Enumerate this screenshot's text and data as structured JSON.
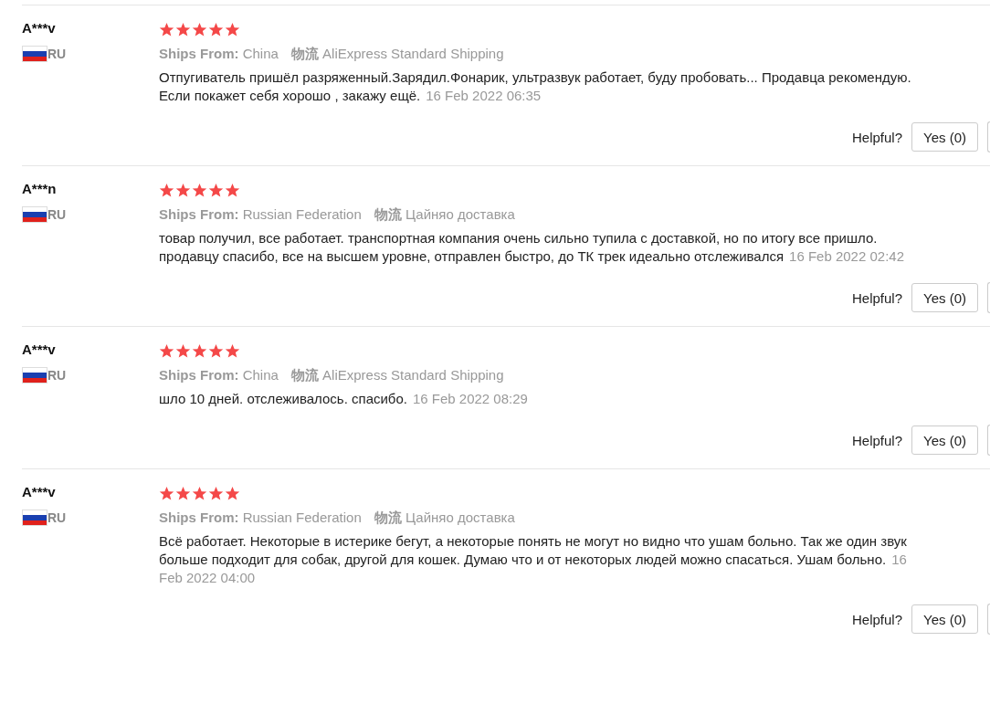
{
  "reviews": [
    {
      "user": "A***v",
      "country": "RU",
      "stars": 5,
      "ships_from_label": "Ships From:",
      "ships_from": "China",
      "logistics_label": "物流",
      "logistics": "AliExpress Standard Shipping",
      "text": "Отпугиватель пришёл разряженный.Зарядил.Фонарик, ультразвук работает, буду пробовать... Продавца рекомендую. Если покажет себя хорошо , закажу ещё.",
      "date": "16 Feb 2022 06:35",
      "helpful_label": "Helpful?",
      "yes_button": "Yes (0)"
    },
    {
      "user": "A***n",
      "country": "RU",
      "stars": 5,
      "ships_from_label": "Ships From:",
      "ships_from": "Russian Federation",
      "logistics_label": "物流",
      "logistics": "Цайняо доставка",
      "text": "товар получил, все работает. транспортная компания очень сильно тупила с доставкой, но по итогу все пришло. продавцу спасибо, все на высшем уровне, отправлен быстро, до ТК трек идеально отслеживался",
      "date": "16 Feb 2022 02:42",
      "helpful_label": "Helpful?",
      "yes_button": "Yes (0)"
    },
    {
      "user": "A***v",
      "country": "RU",
      "stars": 5,
      "ships_from_label": "Ships From:",
      "ships_from": "China",
      "logistics_label": "物流",
      "logistics": "AliExpress Standard Shipping",
      "text": "шло 10 дней. отслеживалось. спасибо.",
      "date": "16 Feb 2022 08:29",
      "helpful_label": "Helpful?",
      "yes_button": "Yes (0)"
    },
    {
      "user": "A***v",
      "country": "RU",
      "stars": 5,
      "ships_from_label": "Ships From:",
      "ships_from": "Russian Federation",
      "logistics_label": "物流",
      "logistics": "Цайняо доставка",
      "text": "Всё работает. Некоторые в истерике бегут, а некоторые понять не могут но видно что ушам больно. Так же один звук больше подходит для собак, другой для кошек. Думаю что и от некоторых людей можно спасаться. Ушам больно.",
      "date": "16 Feb 2022 04:00",
      "helpful_label": "Helpful?",
      "yes_button": "Yes (0)"
    }
  ]
}
